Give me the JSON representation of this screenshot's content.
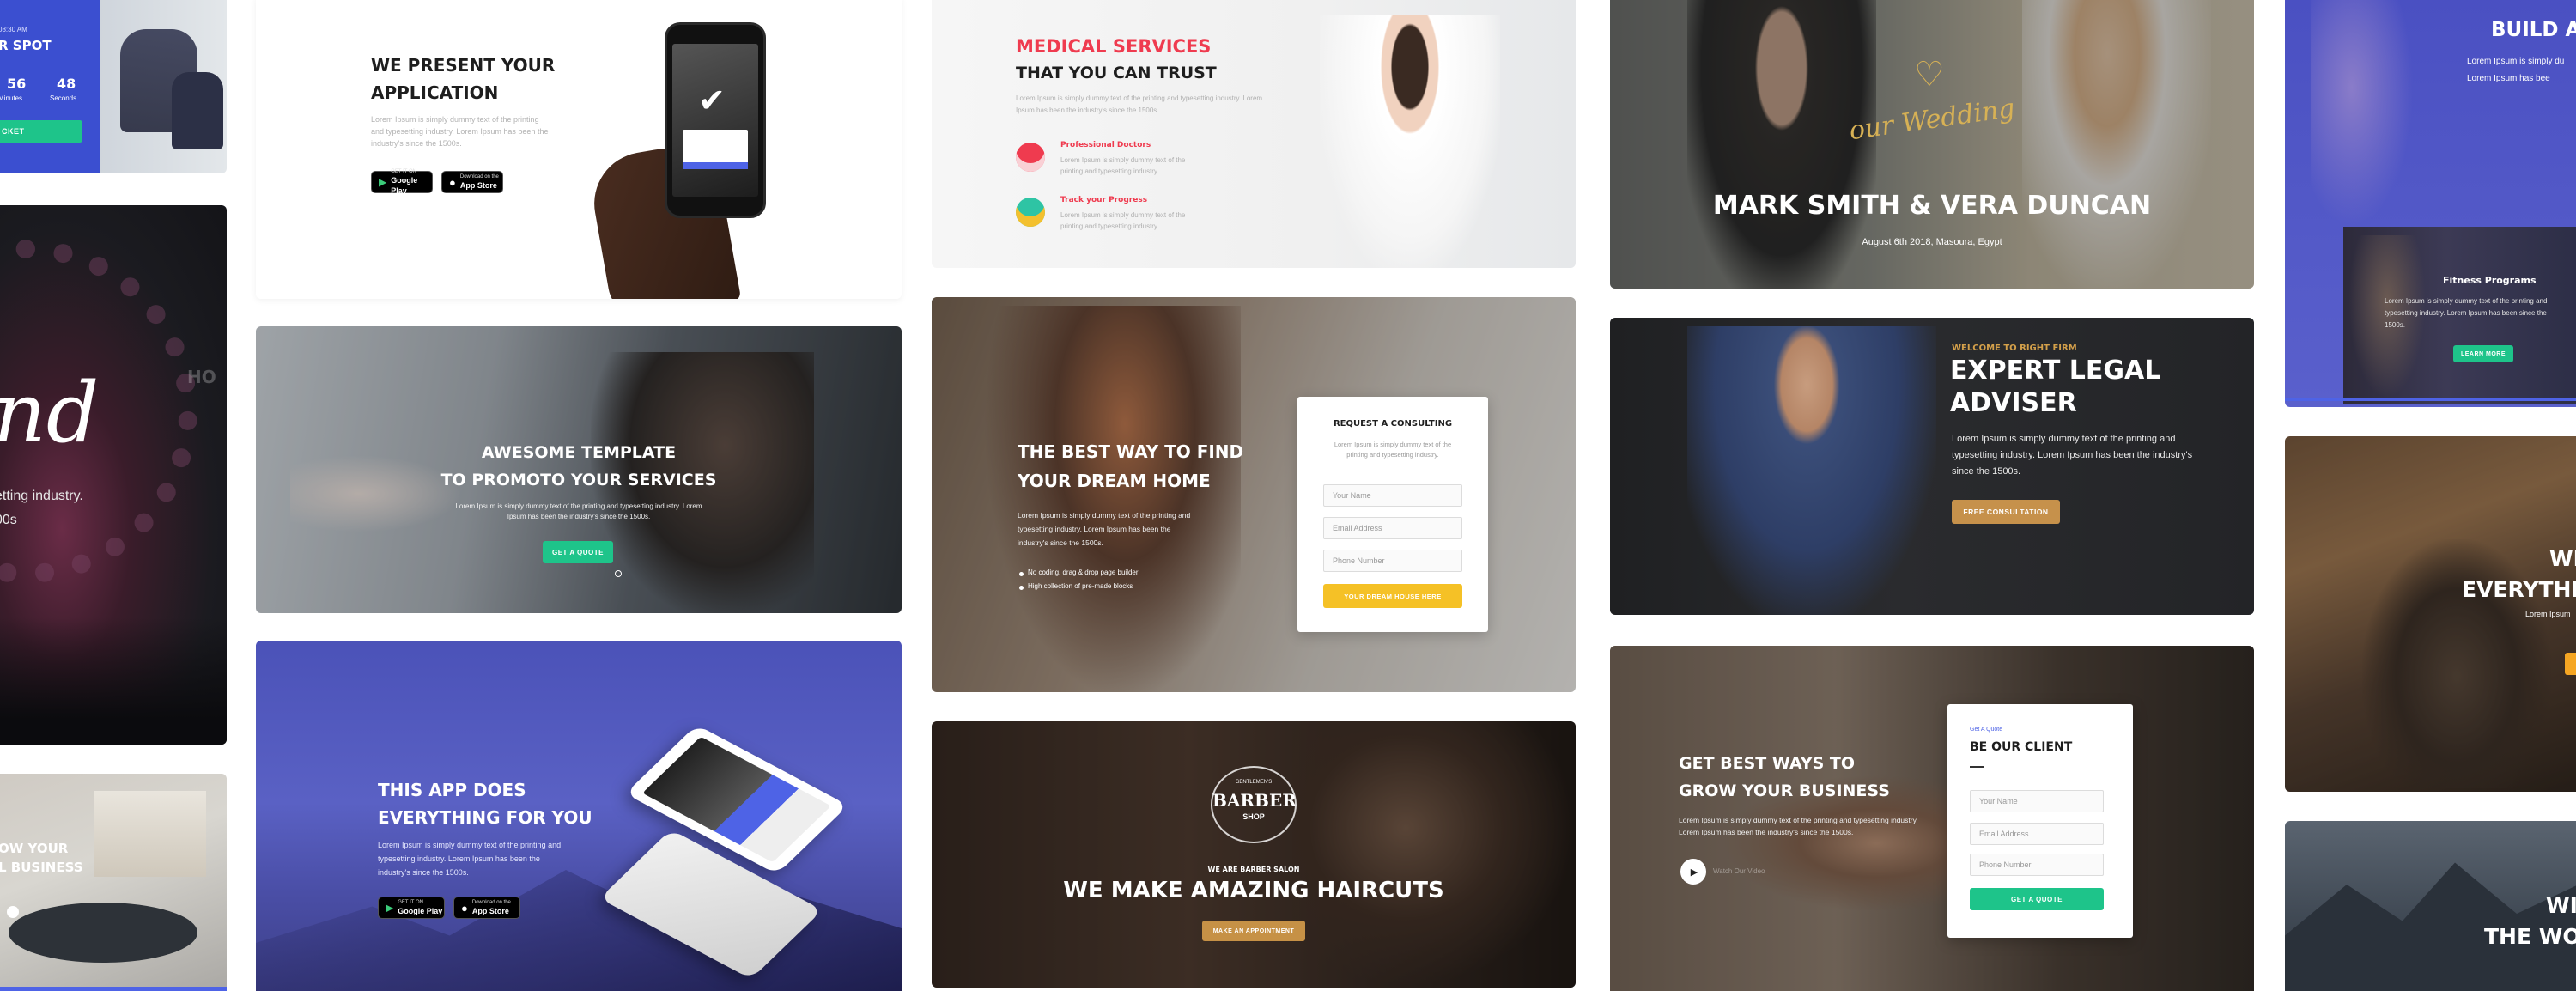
{
  "colA": {
    "countdown": {
      "time_label": "08:30 AM",
      "title_fragment": "R SPOT",
      "num1": "56",
      "label1": "Minutes",
      "num2": "48",
      "label2": "Seconds",
      "button_fragment": "CKET"
    },
    "concert": {
      "script_fragment": "nd",
      "line1": "etting industry.",
      "line2": "00s",
      "side_text": "HO"
    },
    "office": {
      "line1": "OW YOUR",
      "line2": "L BUSINESS"
    }
  },
  "colB": {
    "app": {
      "heading1": "WE PRESENT YOUR",
      "heading2": "APPLICATION",
      "body": "Lorem Ipsum is simply dummy text of the printing and typesetting industry. Lorem Ipsum has been the industry's since the 1500s.",
      "google_small": "GET IT ON",
      "google_big": "Google Play",
      "apple_small": "Download on the",
      "apple_big": "App Store"
    },
    "template": {
      "heading1": "AWESOME TEMPLATE",
      "heading2": "TO PROMOTO YOUR SERVICES",
      "body": "Lorem Ipsum is simply dummy text of the printing and typesetting industry. Lorem Ipsum has been the industry's since the 1500s.",
      "button": "GET A QUOTE"
    },
    "app2": {
      "heading1": "THIS APP DOES",
      "heading2": "EVERYTHING FOR YOU",
      "body": "Lorem Ipsum is simply dummy text of the printing and typesetting industry. Lorem Ipsum has been the industry's since the 1500s.",
      "google_small": "GET IT ON",
      "google_big": "Google Play",
      "apple_small": "Download on the",
      "apple_big": "App Store"
    }
  },
  "colC": {
    "medical": {
      "heading1": "MEDICAL SERVICES",
      "heading2": "THAT YOU CAN TRUST",
      "body": "Lorem Ipsum is simply dummy text of the printing and typesetting industry. Lorem Ipsum has been the industry's since the 1500s.",
      "feature1_title": "Professional Doctors",
      "feature1_body": "Lorem Ipsum is simply dummy text of the printing and typesetting industry.",
      "feature2_title": "Track your Progress",
      "feature2_body": "Lorem Ipsum is simply dummy text of the printing and typesetting industry."
    },
    "realestate": {
      "heading1": "THE BEST WAY TO FIND",
      "heading2": "YOUR DREAM HOME",
      "body": "Lorem Ipsum is simply dummy text of the printing and typesetting industry. Lorem Ipsum has been the industry's since the 1500s.",
      "bullet1": "No coding, drag & drop page builder",
      "bullet2": "High collection of pre-made blocks",
      "form_title": "REQUEST A CONSULTING",
      "form_body": "Lorem Ipsum is simply dummy text of the printing and typesetting industry.",
      "field1": "Your Name",
      "field2": "Email Address",
      "field3": "Phone Number",
      "button": "YOUR DREAM HOUSE HERE"
    },
    "barber": {
      "logo_top": "GENTLEMEN'S",
      "logo_main": "BARBER",
      "logo_bottom": "SHOP",
      "kicker": "WE ARE BARBER SALON",
      "heading": "WE MAKE AMAZING HAIRCUTS",
      "button": "MAKE AN APPOINTMENT"
    }
  },
  "colD": {
    "wedding": {
      "script": "our Wedding",
      "names": "MARK SMITH & VERA DUNCAN",
      "date": "August 6th 2018, Masoura, Egypt"
    },
    "legal": {
      "kicker": "WELCOME TO RIGHT FIRM",
      "heading1": "EXPERT LEGAL",
      "heading2": "ADVISER",
      "body": "Lorem Ipsum is simply dummy text of the printing and typesetting industry. Lorem Ipsum has been the industry's since the 1500s.",
      "button": "FREE CONSULTATION"
    },
    "business": {
      "heading1": "GET BEST WAYS TO",
      "heading2": "GROW YOUR BUSINESS",
      "body": "Lorem Ipsum is simply dummy text of the printing and typesetting industry. Lorem Ipsum has been the industry's since the 1500s.",
      "video_label": "Watch Our Video",
      "form_kicker": "Get A Quote",
      "form_title": "BE OUR CLIENT",
      "field1": "Your Name",
      "field2": "Email Address",
      "field3": "Phone Number",
      "button": "GET A QUOTE"
    }
  },
  "colE": {
    "build": {
      "heading": "BUILD A",
      "line1": "Lorem Ipsum is simply du",
      "line2": "Lorem Ipsum has bee",
      "inner_title": "Fitness Programs",
      "inner_body": "Lorem Ipsum is simply dummy text of the printing and typesetting industry. Lorem Ipsum has been since the 1500s.",
      "inner_button": "LEARN MORE"
    },
    "construction": {
      "heading1": "WE",
      "heading2": "EVERYTHI",
      "line": "Lorem Ipsum"
    },
    "mountain": {
      "heading1": "WIT",
      "heading2": "THE WO"
    }
  }
}
